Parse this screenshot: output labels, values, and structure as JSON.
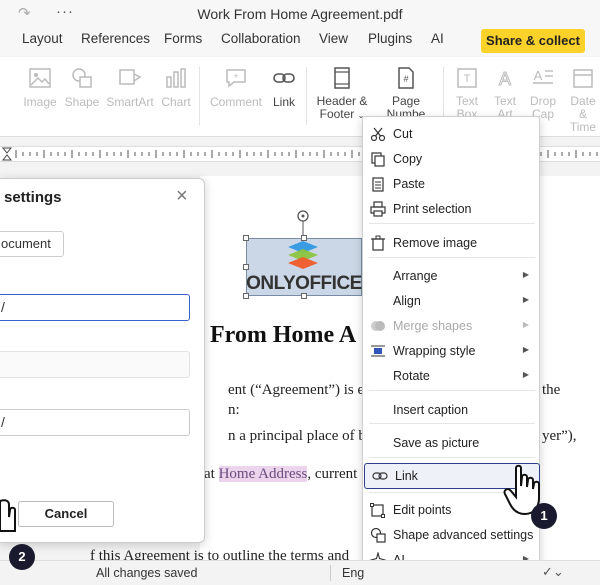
{
  "window": {
    "title": "Work From Home Agreement.pdf",
    "more_glyph": "···"
  },
  "menu": {
    "tabs": [
      "Layout",
      "References",
      "Forms",
      "Collaboration",
      "View",
      "Plugins",
      "AI"
    ],
    "share_label": "Share & collect"
  },
  "toolbar": {
    "image_label": "Image",
    "shape_label": "Shape",
    "smartart_label": "SmartArt",
    "chart_label": "Chart",
    "comment_label": "Comment",
    "link_label": "Link",
    "header_footer_label_1": "Header &",
    "header_footer_label_2": "Footer",
    "page_number_label_1": "Page",
    "page_number_label_2": "Numbe",
    "text_box_label_1": "Text",
    "text_box_label_2": "Box",
    "text_art_label_1": "Text",
    "text_art_label_2": "Art",
    "drop_cap_label_1": "Drop",
    "drop_cap_label_2": "Cap",
    "date_time_label_1": "Date &",
    "date_time_label_2": "Time"
  },
  "document": {
    "logo_text": "ONLYOFFICE",
    "heading": "From Home A",
    "line1_a": "ent (“Agreement”) is enter",
    "line1_b": "the",
    "line2": "n:",
    "line3_a": "n a principal place of busi",
    "line3_b": "yer”),",
    "line4_a": "at ",
    "line4_highlight": "Home Address",
    "line4_b": ", current",
    "line5": "f this Agreement is to outline the terms and"
  },
  "dialog": {
    "title": "settings",
    "doc_button_label": "ocument",
    "input1_value": "/",
    "input3_value": "/",
    "ok_label": "",
    "cancel_label": "Cancel"
  },
  "context_menu": {
    "items": [
      {
        "label": "Cut",
        "icon": "scissors-icon"
      },
      {
        "label": "Copy",
        "icon": "copy-icon"
      },
      {
        "label": "Paste",
        "icon": "paste-icon"
      },
      {
        "label": "Print selection",
        "icon": "printer-icon"
      },
      {
        "label": "Remove image",
        "icon": "trash-icon"
      },
      {
        "label": "Arrange"
      },
      {
        "label": "Align"
      },
      {
        "label": "Merge shapes",
        "icon": "merge-shapes-icon"
      },
      {
        "label": "Wrapping style",
        "icon": "wrap-icon"
      },
      {
        "label": "Rotate"
      },
      {
        "label": "Insert caption"
      },
      {
        "label": "Save as picture"
      },
      {
        "label": "Link",
        "icon": "link-icon"
      },
      {
        "label": "Edit points",
        "icon": "edit-points-icon"
      },
      {
        "label": "Shape advanced settings",
        "icon": "shape-settings-icon"
      },
      {
        "label": "AI",
        "icon": "ai-sparkle-icon"
      }
    ]
  },
  "status": {
    "saved_text": "All changes saved",
    "language": "Eng"
  },
  "badges": {
    "step1": "1",
    "step2": "2"
  },
  "colors": {
    "accent": "#fbd229",
    "primary_blue": "#3e63c8",
    "hover_border": "#2f3f8a",
    "badge": "#1a1a2e"
  }
}
